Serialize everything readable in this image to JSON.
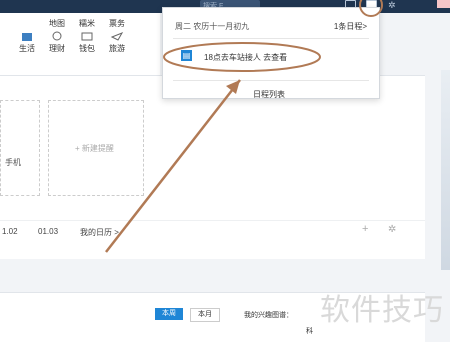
{
  "topbar": {
    "search_placeholder": "搜索 F"
  },
  "quick_links": [
    {
      "label": "生活",
      "icon": "shopping-bag-icon"
    },
    {
      "label": "理财",
      "icon": "money-icon"
    },
    {
      "label": "钱包",
      "icon": "wallet-icon"
    },
    {
      "label": "旅游",
      "icon": "plane-icon"
    },
    {
      "label": "地图",
      "icon": "map-icon"
    },
    {
      "label": "糯米",
      "icon": "group-buy-icon"
    },
    {
      "label": "票务",
      "icon": "ticket-icon"
    }
  ],
  "cards": {
    "phone_partial": "手机",
    "new_reminder": "+ 新建提醒"
  },
  "calendar_row": {
    "date1": "1.02",
    "date2": "01.03",
    "my_calendar": "我的日历 >"
  },
  "lower": {
    "this_week": "本周",
    "this_month": "本月",
    "interest_legend": "我的兴趣图谱："
  },
  "dropdown": {
    "date_line": "周二 农历十一月初九",
    "count": "1条日程>",
    "item_text": "18点去车站接人  去查看",
    "list_link": "日程列表"
  },
  "watermark": {
    "text": "软件技巧",
    "small": "科"
  },
  "colors": {
    "topbar": "#1f3550",
    "accent": "#1f86d6",
    "annotation": "#b17a55"
  }
}
